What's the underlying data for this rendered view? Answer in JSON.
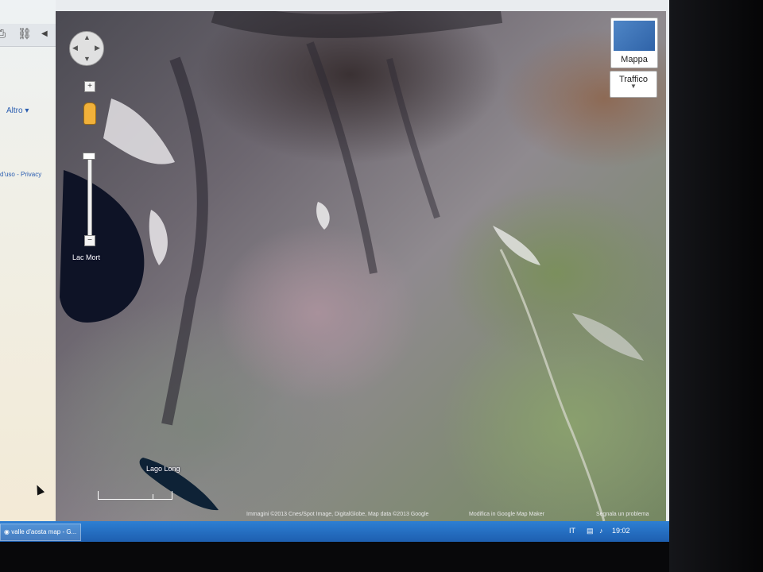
{
  "sidebar": {
    "more_link": "Altro",
    "terms_link": "d'uso - Privacy"
  },
  "map": {
    "places": {
      "lac_mort": "Lac Mort",
      "lago_long": "Lago Long"
    },
    "controls": {
      "map_type_label": "Mappa",
      "traffic_label": "Traffico",
      "zoom_in": "+",
      "zoom_out": "−"
    },
    "attribution": "Immagini ©2013 Cnes/Spot Image, DigitalGlobe, Map data ©2013 Google",
    "edit_link": "Modifica in Google Map Maker",
    "report_link": "Segnala un problema"
  },
  "taskbar": {
    "window_title": "valle d'aosta map - G...",
    "clock": "19:02"
  },
  "colors": {
    "taskbar": "#2d7fd3",
    "link": "#2a5db0"
  }
}
